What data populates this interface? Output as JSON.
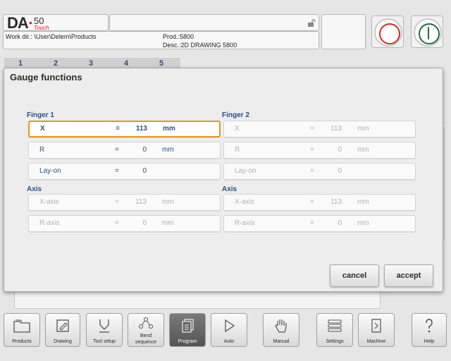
{
  "header": {
    "logo_main": "DA",
    "logo_dot": "•",
    "logo_model": "50",
    "logo_sub": "Touch",
    "work_dir": "Work dir.: \\User\\Delem\\Products",
    "prod": "Prod.:5800",
    "desc": "Desc.:2D DRAWING 5800"
  },
  "steps": [
    "1",
    "2",
    "3",
    "4",
    "5"
  ],
  "dialog": {
    "title": "Gauge functions",
    "finger1": {
      "label": "Finger 1",
      "rows": [
        {
          "name": "X",
          "eq": "=",
          "value": "113",
          "unit": "mm"
        },
        {
          "name": "R",
          "eq": "=",
          "value": "0",
          "unit": "mm"
        },
        {
          "name": "Lay-on",
          "eq": "=",
          "value": "0",
          "unit": ""
        }
      ]
    },
    "finger2": {
      "label": "Finger 2",
      "rows": [
        {
          "name": "X",
          "eq": "=",
          "value": "113",
          "unit": "mm"
        },
        {
          "name": "R",
          "eq": "=",
          "value": "0",
          "unit": "mm"
        },
        {
          "name": "Lay-on",
          "eq": "=",
          "value": "0",
          "unit": ""
        }
      ]
    },
    "axis1": {
      "label": "Axis",
      "rows": [
        {
          "name": "X-axis",
          "eq": "=",
          "value": "113",
          "unit": "mm"
        },
        {
          "name": "R-axis",
          "eq": "=",
          "value": "0",
          "unit": "mm"
        }
      ]
    },
    "axis2": {
      "label": "Axis",
      "rows": [
        {
          "name": "X-axis",
          "eq": "=",
          "value": "113",
          "unit": "mm"
        },
        {
          "name": "R-axis",
          "eq": "=",
          "value": "0",
          "unit": "mm"
        }
      ]
    },
    "cancel": "cancel",
    "accept": "accept"
  },
  "nav": {
    "products": "Products",
    "drawing": "Drawing",
    "tool_setup": "Tool setup",
    "bend_sequence_1": "Bend",
    "bend_sequence_2": "sequence",
    "program": "Program",
    "auto": "Auto",
    "manual": "Manual",
    "settings": "Settings",
    "machine": "Machine",
    "help": "Help"
  },
  "icons": {
    "lock": "unlock-icon",
    "stop": "stop-icon",
    "start": "start-icon"
  },
  "colors": {
    "accent_blue": "#2a4f85",
    "focus_orange": "#e8951e",
    "stop_red": "#d8262b",
    "start_green": "#1f6b3a"
  }
}
